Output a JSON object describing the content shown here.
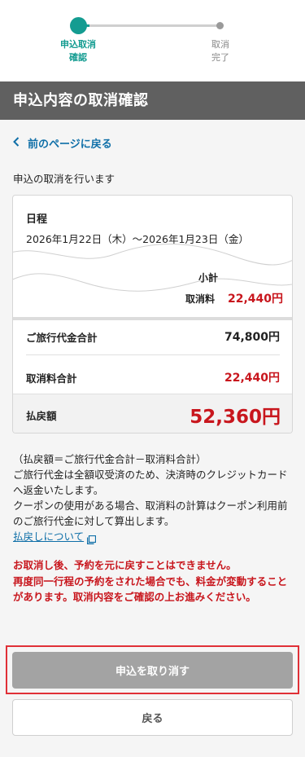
{
  "stepper": {
    "step1_line1": "申込取消",
    "step1_line2": "確認",
    "step2_line1": "取消",
    "step2_line2": "完了"
  },
  "header": {
    "title": "申込内容の取消確認"
  },
  "back_link": {
    "label": "前のページに戻る"
  },
  "intro": "申込の取消を行います",
  "schedule": {
    "title": "日程",
    "text": "2026年1月22日（木）～2026年1月23日（金）"
  },
  "partial": {
    "subtotal_label": "小計",
    "fee_label": "取消料",
    "fee_value": "22,440円"
  },
  "summary": {
    "total_label": "ご旅行代金合計",
    "total_value": "74,800円",
    "fee_total_label": "取消料合計",
    "fee_total_value": "22,440円",
    "refund_label": "払戻額",
    "refund_value": "52,360円"
  },
  "notes": {
    "line1": "（払戻額＝ご旅行代金合計－取消料合計）",
    "line2": "ご旅行代金は全額収受済のため、決済時のクレジットカードへ返金いたします。",
    "line3": "クーポンの使用がある場合、取消料の計算はクーポン利用前のご旅行代金に対して算出します。",
    "link_label": "払戻しについて"
  },
  "warning": {
    "line1": "お取消し後、予約を元に戻すことはできません。",
    "line2": "再度同一行程の予約をされた場合でも、料金が変動することがあります。取消内容をご確認の上お進みください。"
  },
  "buttons": {
    "cancel_label": "申込を取り消す",
    "back_label": "戻る"
  },
  "colors": {
    "accent": "#149c91",
    "header_bg": "#606060",
    "alert_red": "#c8161d",
    "link_blue": "#0f6fa8",
    "disabled_button": "#a3a3a3"
  }
}
